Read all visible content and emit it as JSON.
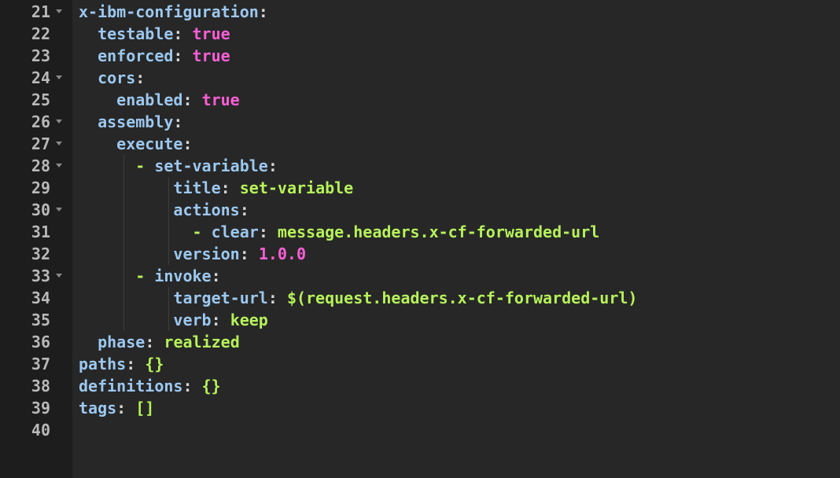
{
  "lines": [
    {
      "n": "21",
      "fold": true,
      "indent": "",
      "key": "x-ibm-configuration",
      "sep": ":",
      "val": "",
      "vt": ""
    },
    {
      "n": "22",
      "fold": false,
      "indent": "  ",
      "key": "testable",
      "sep": ": ",
      "val": "true",
      "vt": "b"
    },
    {
      "n": "23",
      "fold": false,
      "indent": "  ",
      "key": "enforced",
      "sep": ": ",
      "val": "true",
      "vt": "b"
    },
    {
      "n": "24",
      "fold": true,
      "indent": "  ",
      "key": "cors",
      "sep": ":",
      "val": "",
      "vt": ""
    },
    {
      "n": "25",
      "fold": false,
      "indent": "    ",
      "key": "enabled",
      "sep": ": ",
      "val": "true",
      "vt": "b"
    },
    {
      "n": "26",
      "fold": true,
      "indent": "  ",
      "key": "assembly",
      "sep": ":",
      "val": "",
      "vt": ""
    },
    {
      "n": "27",
      "fold": true,
      "indent": "    ",
      "key": "execute",
      "sep": ":",
      "val": "",
      "vt": ""
    },
    {
      "n": "28",
      "fold": true,
      "indent": "      ",
      "dash": "- ",
      "key": "set-variable",
      "sep": ":",
      "val": "",
      "vt": ""
    },
    {
      "n": "29",
      "fold": false,
      "indent": "          ",
      "key": "title",
      "sep": ": ",
      "val": "set-variable",
      "vt": "s"
    },
    {
      "n": "30",
      "fold": true,
      "indent": "          ",
      "key": "actions",
      "sep": ":",
      "val": "",
      "vt": ""
    },
    {
      "n": "31",
      "fold": false,
      "indent": "            ",
      "dash": "- ",
      "key": "clear",
      "sep": ": ",
      "val": "message.headers.x-cf-forwarded-url",
      "vt": "s"
    },
    {
      "n": "32",
      "fold": false,
      "indent": "          ",
      "key": "version",
      "sep": ": ",
      "val": "1.0.0",
      "vt": "n"
    },
    {
      "n": "33",
      "fold": true,
      "indent": "      ",
      "dash": "- ",
      "key": "invoke",
      "sep": ":",
      "val": "",
      "vt": ""
    },
    {
      "n": "34",
      "fold": false,
      "indent": "          ",
      "key": "target-url",
      "sep": ": ",
      "val": "$(request.headers.x-cf-forwarded-url)",
      "vt": "s"
    },
    {
      "n": "35",
      "fold": false,
      "indent": "          ",
      "key": "verb",
      "sep": ": ",
      "val": "keep",
      "vt": "s"
    },
    {
      "n": "36",
      "fold": false,
      "indent": "  ",
      "key": "phase",
      "sep": ": ",
      "val": "realized",
      "vt": "s"
    },
    {
      "n": "37",
      "fold": false,
      "indent": "",
      "key": "paths",
      "sep": ": ",
      "val": "{}",
      "vt": "s"
    },
    {
      "n": "38",
      "fold": false,
      "indent": "",
      "key": "definitions",
      "sep": ": ",
      "val": "{}",
      "vt": "s"
    },
    {
      "n": "39",
      "fold": false,
      "indent": "",
      "key": "tags",
      "sep": ": ",
      "val": "[]",
      "vt": "s"
    },
    {
      "n": "40",
      "fold": false,
      "indent": "",
      "key": "",
      "sep": "",
      "val": "",
      "vt": ""
    }
  ],
  "colors": {
    "key": "#9cc8f0",
    "boolean": "#ff5fd7",
    "number": "#ff5fd7",
    "string": "#b6f25a",
    "gutter_bg": "#1d1d1d",
    "editor_bg": "#272727"
  },
  "icons": {
    "fold": "chevron-down-icon"
  }
}
